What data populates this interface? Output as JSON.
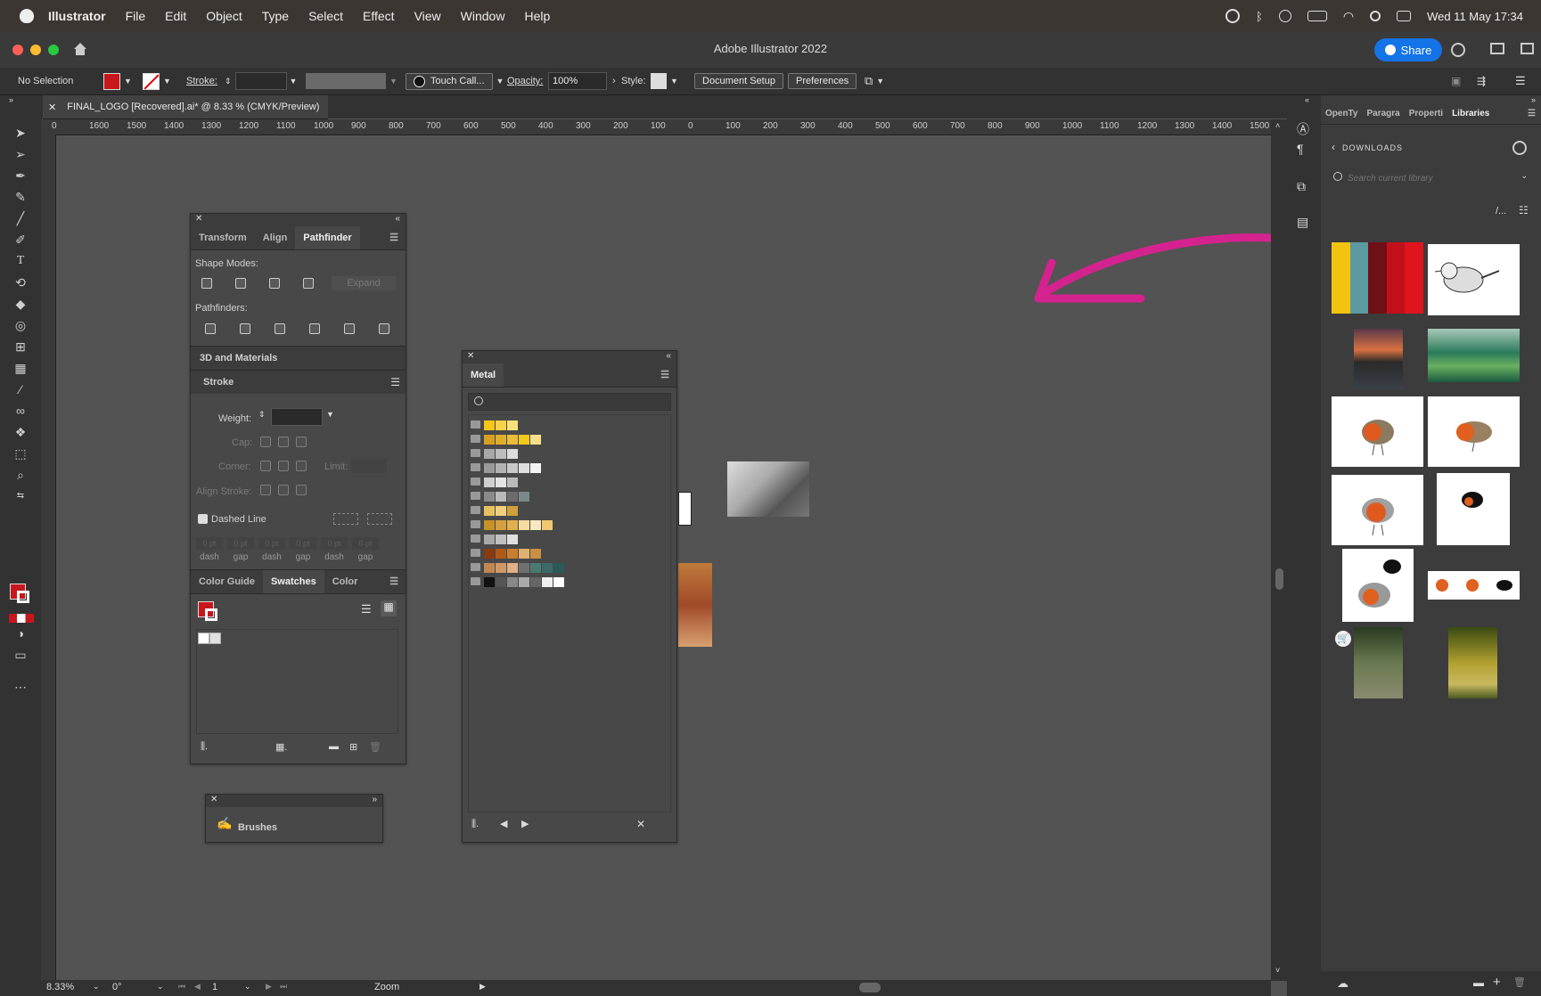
{
  "menubar": {
    "app_name": "Illustrator",
    "items": [
      "File",
      "Edit",
      "Object",
      "Type",
      "Select",
      "Effect",
      "View",
      "Window",
      "Help"
    ],
    "datetime": "Wed 11 May  17:34"
  },
  "titlebar": {
    "title": "Adobe Illustrator 2022",
    "share_label": "Share"
  },
  "control_bar": {
    "selection": "No Selection",
    "stroke_label": "Stroke:",
    "brush_label": "Touch Call...",
    "opacity_label": "Opacity:",
    "opacity_value": "100%",
    "style_label": "Style:",
    "doc_setup": "Document Setup",
    "preferences": "Preferences"
  },
  "document": {
    "tab_title": "FINAL_LOGO [Recovered].ai* @ 8.33 % (CMYK/Preview)"
  },
  "ruler": {
    "labels": [
      "0",
      "1600",
      "1500",
      "1400",
      "1300",
      "1200",
      "1100",
      "1000",
      "900",
      "800",
      "700",
      "600",
      "500",
      "400",
      "300",
      "200",
      "100",
      "0",
      "100",
      "200",
      "300",
      "400",
      "500",
      "600",
      "700",
      "800",
      "900",
      "1000",
      "1100",
      "1200",
      "1300",
      "1400",
      "1500"
    ]
  },
  "pathfinder_panel": {
    "tabs": [
      "Transform",
      "Align",
      "Pathfinder"
    ],
    "shape_modes_label": "Shape Modes:",
    "expand_label": "Expand",
    "pathfinders_label": "Pathfinders:",
    "materials_label": "3D and Materials",
    "stroke_title": "Stroke",
    "weight_label": "Weight:",
    "cap_label": "Cap:",
    "corner_label": "Corner:",
    "limit_label": "Limit:",
    "align_stroke_label": "Align Stroke:",
    "dashed_line_label": "Dashed Line",
    "dash_values": [
      "0 pt",
      "0 pt",
      "0 pt",
      "0 pt",
      "0 pt",
      "0 pt"
    ],
    "dash_labels": [
      "dash",
      "gap",
      "dash",
      "gap",
      "dash",
      "gap"
    ],
    "swatch_tabs": [
      "Color Guide",
      "Swatches",
      "Color"
    ]
  },
  "brushes_panel": {
    "title": "Brushes"
  },
  "metal_panel": {
    "title": "Metal",
    "rows": [
      [
        "#f5c518",
        "#f7d24a",
        "#f9e27a"
      ],
      [
        "#d8a020",
        "#e0ae2e",
        "#e9bc3a",
        "#f2c81a",
        "#f7df8a"
      ],
      [
        "#a8a8a8",
        "#bdbdbd",
        "#dcdcdc"
      ],
      [
        "#9a9a9a",
        "#b2b2b2",
        "#c8c8c8",
        "#dedede",
        "#f2f2f2"
      ],
      [
        "#cfcfcf",
        "#e3e3e3",
        "#bababa"
      ],
      [
        "#8a8a8a",
        "#b9b9b9",
        "#6c6c6c",
        "#7a8a8a"
      ],
      [
        "#e8c060",
        "#f0d080",
        "#d0a040"
      ],
      [
        "#c89228",
        "#d4a040",
        "#e0b050",
        "#f5dca0",
        "#f7e8c0",
        "#f0c870"
      ],
      [
        "#a8a8a8",
        "#c0c0c0",
        "#e0e0e0"
      ],
      [
        "#8a3a10",
        "#b05a18",
        "#c88030",
        "#e0b070",
        "#c89040"
      ],
      [
        "#c08850",
        "#d09868",
        "#e0b088",
        "#707070",
        "#4a7a70",
        "#3a6a6a",
        "#2a5a5a"
      ],
      [
        "#111111",
        "#555555",
        "#888888",
        "#aaaaaa",
        "#666666",
        "#eeeeee",
        "#ffffff"
      ]
    ]
  },
  "libraries_panel": {
    "tabs": [
      "OpenTy",
      "Paragra",
      "Properti",
      "Libraries"
    ],
    "back_label": "DOWNLOADS",
    "search_placeholder": "Search current library",
    "palette_colors": [
      "#f2c40f",
      "#5b9aa0",
      "#6e1016",
      "#c2101a",
      "#e0141c"
    ]
  },
  "status_bar": {
    "zoom": "8.33%",
    "rotation": "0°",
    "artboard": "1",
    "mode": "Zoom"
  },
  "colors": {
    "accent": "#1473e6",
    "annotation": "#d4238f"
  }
}
